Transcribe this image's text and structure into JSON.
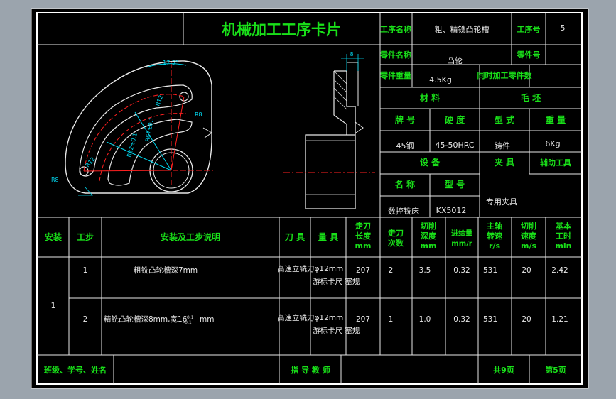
{
  "title": "机械加工工序卡片",
  "header": {
    "op_name_label": "工序名称",
    "op_name_value": "粗、精铣凸轮槽",
    "op_no_label": "工序号",
    "op_no_value": "5",
    "part_name_label": "零件名称",
    "part_name_value": "凸轮",
    "part_no_label": "零件号",
    "part_no_value": "",
    "part_weight_label": "零件重量",
    "part_weight_value": "4.5Kg",
    "same_time_label": "同时加工零件数",
    "same_time_value": ""
  },
  "material": {
    "section_label": "材    料",
    "blank_label": "毛    坯",
    "grade_label": "牌  号",
    "hardness_label": "硬  度",
    "form_label": "型  式",
    "weight_label": "重  量",
    "grade_value": "45钢",
    "hardness_value": "45-50HRC",
    "form_value": "铸件",
    "weight_value": "6Kg"
  },
  "equipment": {
    "equip_label": "设    备",
    "fixture_label": "夹  具",
    "aux_tool_label": "辅助工具",
    "name_label": "名  称",
    "model_label": "型  号",
    "name_value": "数控铣床",
    "model_value": "KX5012",
    "fixture_value": "专用夹具"
  },
  "drawing": {
    "dim_angle": "17.5°",
    "dim_thickness": "8",
    "dim_r12_top": "R12",
    "dim_r8_top": "R8",
    "dim_r8_left": "R8",
    "dim_r12_left": "R12",
    "dim_r67": "R67±0.1",
    "dim_r82": "R82±0.1"
  },
  "table": {
    "headers": {
      "install": "安装",
      "step": "工步",
      "desc": "安装及工步说明",
      "tool": "刀  具",
      "gauge": "量  具",
      "feed_len": "走刀长度mm",
      "passes": "走刀次数",
      "depth": "切削深度mm",
      "feed_rate": "进给量mm/r",
      "spindle": "主轴转速r/s",
      "speed": "切削速度m/s",
      "time": "基本工时min"
    },
    "install_value": "1",
    "rows": [
      {
        "step": "1",
        "desc": "粗铣凸轮槽深7mm",
        "tool": "高速立铣刀φ12mm",
        "gauge": "游标卡尺 塞规",
        "feed_len": "207",
        "passes": "2",
        "depth": "3.5",
        "feed_rate": "0.32",
        "spindle": "531",
        "speed": "20",
        "time": "2.42"
      },
      {
        "step": "2",
        "desc": "精铣凸轮槽深8mm,宽16",
        "desc_tol_upper": "+0.1",
        "desc_tol_lower": "-0.1",
        "desc_unit": "mm",
        "tool": "高速立铣刀φ12mm",
        "gauge": "游标卡尺 塞规",
        "feed_len": "207",
        "passes": "1",
        "depth": "1.0",
        "feed_rate": "0.32",
        "spindle": "531",
        "speed": "20",
        "time": "1.21"
      }
    ]
  },
  "footer": {
    "class_label": "班级、学号、姓名",
    "advisor_label": "指 导 教 师",
    "total_pages": "共9页",
    "page_no": "第5页"
  },
  "colors": {
    "label": "#19e019",
    "line": "#e8e8e8",
    "background": "#000000",
    "frame": "#9ba4ad",
    "drawing_red": "#ff2020",
    "drawing_cyan": "#00d8f0"
  }
}
